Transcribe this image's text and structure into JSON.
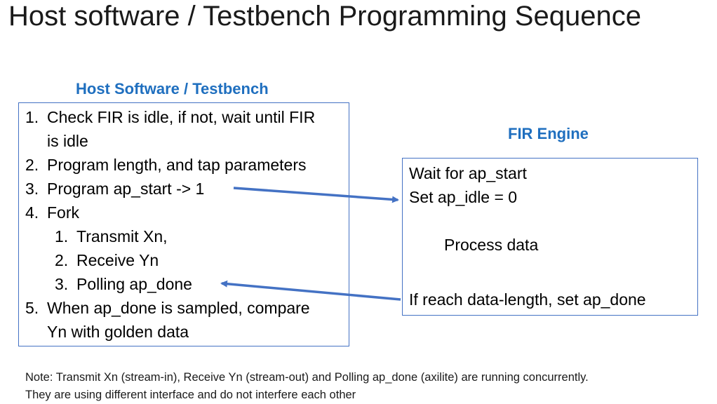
{
  "title": "Host software / Testbench Programming Sequence",
  "colors": {
    "accent": "#1f6fbf",
    "box_border": "#4472c4",
    "arrow": "#4472c4"
  },
  "host": {
    "title": "Host Software / Testbench",
    "steps": [
      {
        "num": "1.",
        "text": "Check FIR is idle, if not, wait until FIR"
      },
      {
        "num": "",
        "text": "is idle"
      },
      {
        "num": "2.",
        "text": "Program length, and tap parameters"
      },
      {
        "num": "3.",
        "text": "Program ap_start -> 1"
      },
      {
        "num": "4.",
        "text": "Fork"
      },
      {
        "num": "1.",
        "text": "Transmit Xn,"
      },
      {
        "num": "2.",
        "text": "Receive Yn"
      },
      {
        "num": "3.",
        "text": "Polling ap_done"
      },
      {
        "num": "5.",
        "text": "When ap_done is sampled, compare"
      },
      {
        "num": "",
        "text": "Yn with golden data"
      }
    ]
  },
  "fir": {
    "title": "FIR Engine",
    "lines": [
      "Wait for ap_start",
      "Set ap_idle = 0",
      "Process data",
      "If reach data-length, set ap_done"
    ]
  },
  "note": {
    "line1": "Note: Transmit Xn (stream-in), Receive Yn (stream-out) and Polling ap_done (axilite) are running concurrently.",
    "line2": "They are using different interface and do not interfere each other"
  }
}
